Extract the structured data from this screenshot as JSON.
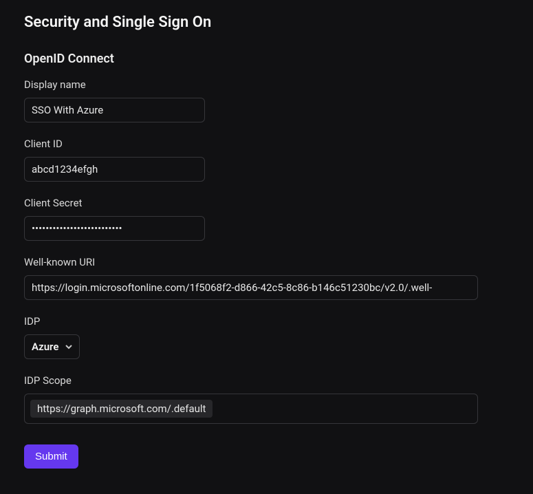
{
  "page": {
    "title": "Security and Single Sign On"
  },
  "section": {
    "title": "OpenID Connect"
  },
  "fields": {
    "display_name": {
      "label": "Display name",
      "value": "SSO With Azure"
    },
    "client_id": {
      "label": "Client ID",
      "value": "abcd1234efgh"
    },
    "client_secret": {
      "label": "Client Secret",
      "value": "••••••••••••••••••••••••••"
    },
    "well_known_uri": {
      "label": "Well-known URI",
      "value": "https://login.microsoftonline.com/1f5068f2-d866-42c5-8c86-b146c51230bc/v2.0/.well-"
    },
    "idp": {
      "label": "IDP",
      "value": "Azure"
    },
    "idp_scope": {
      "label": "IDP Scope",
      "tags": [
        "https://graph.microsoft.com/.default"
      ]
    }
  },
  "actions": {
    "submit": "Submit"
  }
}
